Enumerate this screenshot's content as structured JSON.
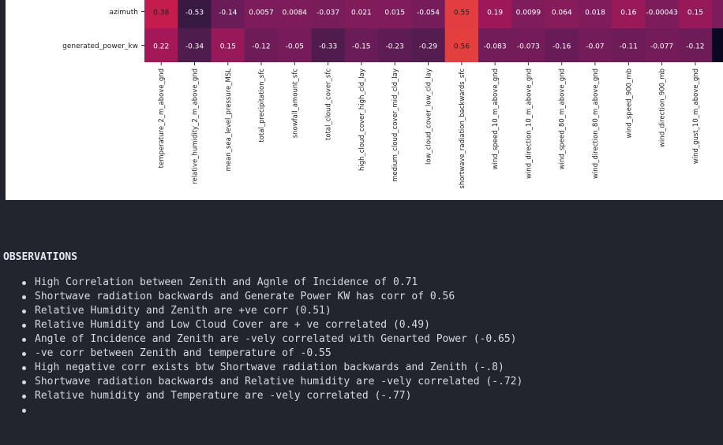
{
  "chart_data": {
    "type": "heatmap",
    "rows": [
      "azimuth",
      "generated_power_kw"
    ],
    "columns": [
      "temperature_2_m_above_gnd",
      "relative_humidity_2_m_above_gnd",
      "mean_sea_level_pressure_MSL",
      "total_precipitation_sfc",
      "snowfall_amount_sfc",
      "total_cloud_cover_sfc",
      "high_cloud_cover_high_cld_lay",
      "medium_cloud_cover_mid_cld_lay",
      "low_cloud_cover_low_cld_lay",
      "shortwave_radiation_backwards_sfc",
      "wind_speed_10_m_above_gnd",
      "wind_direction_10_m_above_gnd",
      "wind_speed_80_m_above_gnd",
      "wind_direction_80_m_above_gnd",
      "wind_speed_900_mb",
      "wind_direction_900_mb",
      "wind_gust_10_m_above_gnd"
    ],
    "values": [
      [
        0.38,
        -0.53,
        -0.14,
        0.0057,
        0.0084,
        -0.037,
        0.021,
        0.015,
        -0.054,
        0.55,
        0.19,
        0.0099,
        0.064,
        0.018,
        0.16,
        -0.00043,
        0.15
      ],
      [
        0.22,
        -0.34,
        0.15,
        -0.12,
        -0.05,
        -0.33,
        -0.15,
        -0.23,
        -0.29,
        0.56,
        -0.083,
        -0.073,
        -0.16,
        -0.07,
        -0.11,
        -0.077,
        -0.12
      ]
    ],
    "value_labels": [
      [
        "0.38",
        "-0.53",
        "-0.14",
        "0.0057",
        "0.0084",
        "-0.037",
        "0.021",
        "0.015",
        "-0.054",
        "0.55",
        "0.19",
        "0.0099",
        "0.064",
        "0.018",
        "0.16",
        "-0.00043",
        "0.15"
      ],
      [
        "0.22",
        "-0.34",
        "0.15",
        "-0.12",
        "-0.05",
        "-0.33",
        "-0.15",
        "-0.23",
        "-0.29",
        "0.56",
        "-0.083",
        "-0.073",
        "-0.16",
        "-0.07",
        "-0.11",
        "-0.077",
        "-0.12"
      ]
    ],
    "colormap": "rocket",
    "vmin": -1,
    "vmax": 1
  },
  "observations": {
    "title": "OBSERVATIONS",
    "items": [
      "High Correlation between Zenith and Agnle of Incidence of 0.71",
      "Shortwave radiation backwards and Generate Power KW has corr of 0.56",
      "Relative Humidity and Zenith are +ve corr (0.51)",
      "Relative Humidity and Low Cloud Cover are + ve correlated (0.49)",
      "Angle of Incidence and Zenith are -vely correlated with Genarted Power (-0.65)",
      "-ve corr between Zenith and temperature of -0.55",
      "High negative corr exists btw Shortwave radiation backwards and Zenith (-.8)",
      "Shortwave radiation backwards and Relative humidity are -vely correlated (-.72)",
      "Relative humidity and Temperature are -vely correlated (-.77)",
      ""
    ]
  }
}
